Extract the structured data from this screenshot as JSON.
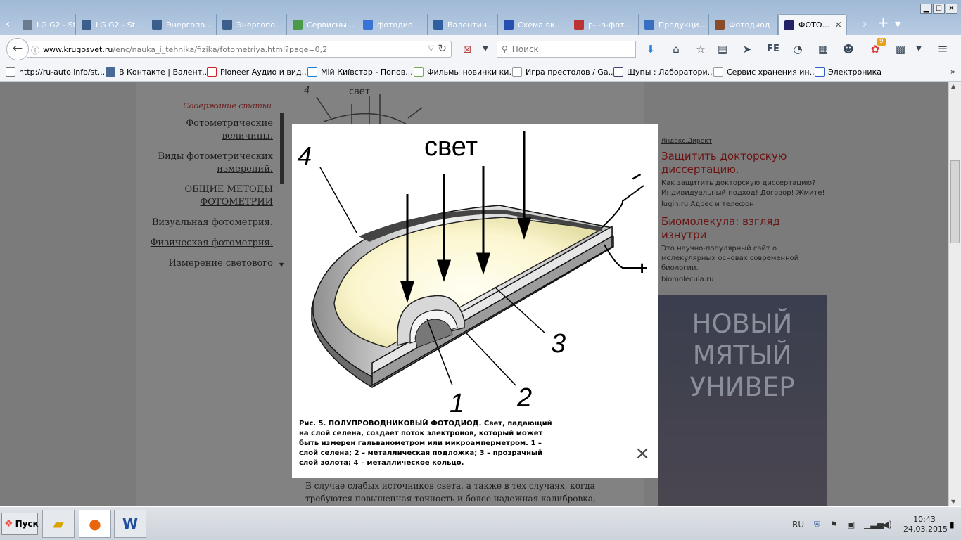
{
  "tabs": [
    {
      "label": "LG G2 - St...",
      "icon": "lg-icon"
    },
    {
      "label": "LG G2 - St...",
      "icon": "four-icon"
    },
    {
      "label": "Энергопо...",
      "icon": "four-icon"
    },
    {
      "label": "Энергопо...",
      "icon": "four-icon"
    },
    {
      "label": "Сервисны...",
      "icon": "service-icon"
    },
    {
      "label": "фотодио...",
      "icon": "google-icon"
    },
    {
      "label": "Валентин ...",
      "icon": "video-icon"
    },
    {
      "label": "Схема вк...",
      "icon": "scheme-icon"
    },
    {
      "label": "p-i-n-фот...",
      "icon": "pin-icon"
    },
    {
      "label": "Продукци...",
      "icon": "product-icon"
    },
    {
      "label": "Фотодиод",
      "icon": "photo-icon"
    },
    {
      "label": "ФОТО...",
      "icon": "krugosvet-icon"
    }
  ],
  "url": {
    "host": "www.krugosvet.ru",
    "path": "/enc/nauka_i_tehnika/fizika/fotometriya.html?page=0,2"
  },
  "search": {
    "placeholder": "Поиск"
  },
  "toolbar": {
    "fe_label": "FE",
    "badge": "9"
  },
  "bookmarks": [
    {
      "label": "http://ru-auto.info/st...",
      "icon": "page-icon"
    },
    {
      "label": "В Контакте | Валент...",
      "icon": "vk-icon"
    },
    {
      "label": "Pioneer Аудио и вид...",
      "icon": "pioneer-icon"
    },
    {
      "label": "Мій Київстар - Попов...",
      "icon": "star-icon"
    },
    {
      "label": "Фильмы новинки ки...",
      "icon": "film-icon"
    },
    {
      "label": "Игра престолов / Ga...",
      "icon": "ex-icon"
    },
    {
      "label": "Щупы : Лаборатори...",
      "icon": "probe-icon"
    },
    {
      "label": "Сервис хранения ин...",
      "icon": "ex-icon"
    },
    {
      "label": "Электроника",
      "icon": "electronics-icon"
    }
  ],
  "toc": {
    "heading": "Содержание статьи",
    "items": [
      "Фотометрические величины.",
      "Виды фотометрических измерений.",
      "ОБЩИЕ МЕТОДЫ ФОТОМЕТРИИ",
      "Визуальная фотометрия.",
      "Физическая фотометрия.",
      "Измерение светового"
    ]
  },
  "behind_figure": {
    "number": "4",
    "light": "свет"
  },
  "sidebar": {
    "direct_label": "Яндекс.Директ",
    "ads": [
      {
        "title": "Защитить докторскую диссертацию.",
        "text": "Как защитить докторскую диссертацию? Индивидуальный подход! Договор! Жмите!",
        "domain": "lugin.ru    Адрес и телефон"
      },
      {
        "title": "Биомолекула: взгляд изнутри",
        "text": "Это научно-популярный сайт о молекулярных основах современной биологии.",
        "domain": "biomolecula.ru"
      }
    ],
    "banner": [
      "НОВЫЙ",
      "МЯТЫЙ",
      "УНИВЕР"
    ]
  },
  "article": {
    "text": "В случае слабых источников света, а также в тех случаях, когда требуются повышенная точность и более надежная калибровка, фотометристы"
  },
  "figure": {
    "light_label": "свет",
    "labels": [
      "1",
      "2",
      "3",
      "4"
    ],
    "minus": "–",
    "plus": "+",
    "caption": "Рис. 5. ПОЛУПРОВОДНИКОВЫЙ ФОТОДИОД. Свет, падающий на слой селена, создает поток электронов, который может быть измерен гальванометром или микроамперметром. 1 – слой селена; 2 – металлическая подложка; 3 – прозрачный слой золота; 4 – металлическое кольцо.",
    "close": "×"
  },
  "taskbar": {
    "start": "Пуск",
    "lang": "RU",
    "time": "10:43",
    "date": "24.03.2015"
  }
}
